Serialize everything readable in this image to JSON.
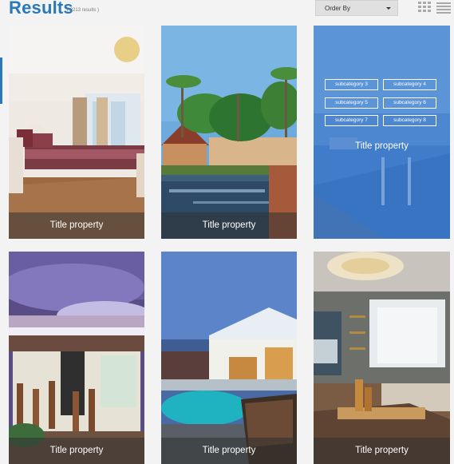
{
  "header": {
    "title": "Results",
    "count": "( 2213 results )",
    "order_by": "Order By"
  },
  "cards": [
    {
      "caption": "Title property"
    },
    {
      "caption": "Title property"
    },
    {
      "caption": "Title property",
      "subcategories": [
        "subcategory 3",
        "subcategory 4",
        "subcategory 5",
        "subcategory 6",
        "subcategory 7",
        "subcategory 8"
      ]
    },
    {
      "caption": "Title property"
    },
    {
      "caption": "Title property"
    },
    {
      "caption": "Title property"
    }
  ],
  "colors": {
    "accent": "#2a78b8",
    "hover_overlay": "#2f6fc4"
  }
}
